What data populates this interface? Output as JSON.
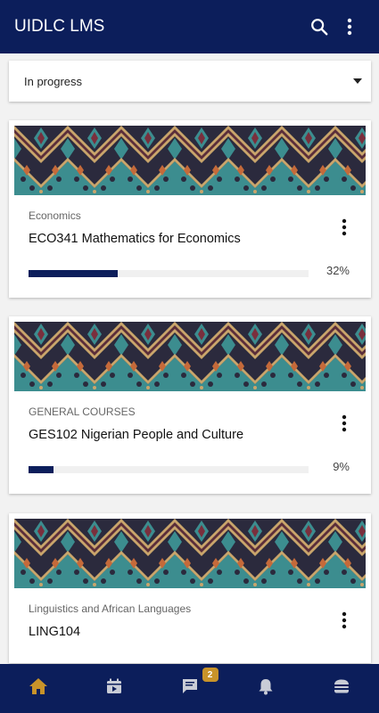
{
  "appbar": {
    "title": "UIDLC LMS",
    "search_icon": "search-icon",
    "more_icon": "more-vert-icon"
  },
  "filter": {
    "value": "In progress"
  },
  "courses": [
    {
      "category": "Economics",
      "name": "ECO341 Mathematics for Economics",
      "progress_label": "32%",
      "progress": 32
    },
    {
      "category": "GENERAL COURSES",
      "name": "GES102 Nigerian People and Culture",
      "progress_label": "9%",
      "progress": 9
    },
    {
      "category": "Linguistics and African Languages",
      "name": "LING104"
    }
  ],
  "bottom_nav": {
    "tabs": [
      "home-icon",
      "calendar-icon",
      "messages-icon",
      "notifications-icon",
      "menu-icon"
    ],
    "messages_badge": "2"
  },
  "colors": {
    "primary": "#0c1e5b",
    "active_tab": "#c8932a",
    "inactive_tab": "#c9ccd6",
    "badge": "#c8932a",
    "progress_fill": "#0c1e5b"
  }
}
